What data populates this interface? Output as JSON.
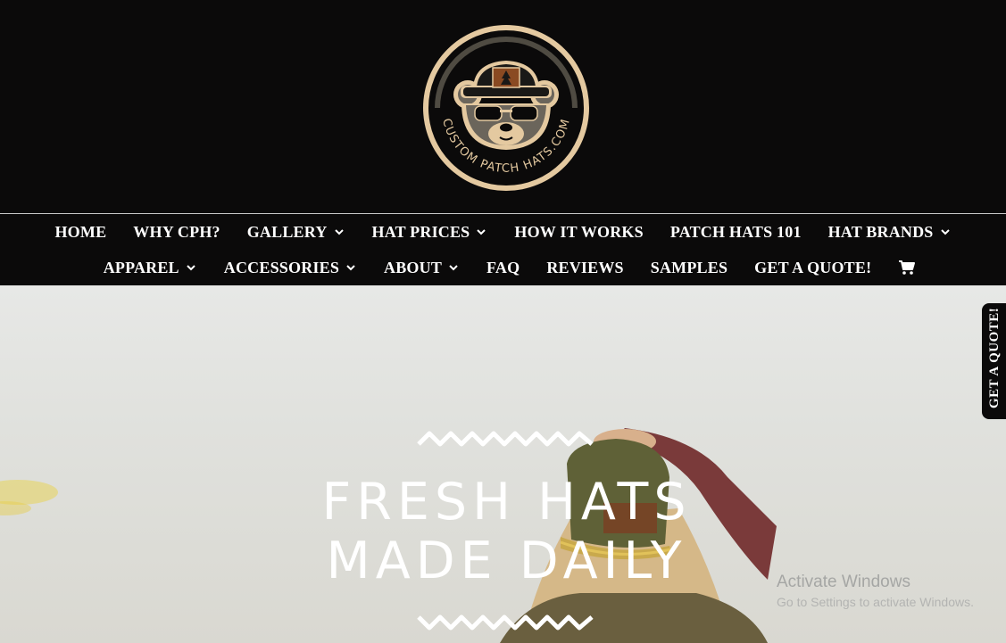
{
  "brand": {
    "logo_text": "CUSTOM PATCH HATS.COM",
    "colors": {
      "bg": "#0b0a0a",
      "ring": "#e4c9a0",
      "accent": "#8a4a22",
      "text": "#ffffff"
    }
  },
  "nav": {
    "row1": [
      {
        "label": "HOME",
        "dropdown": false
      },
      {
        "label": "WHY CPH?",
        "dropdown": false
      },
      {
        "label": "GALLERY",
        "dropdown": true
      },
      {
        "label": "HAT PRICES",
        "dropdown": true
      },
      {
        "label": "HOW IT WORKS",
        "dropdown": false
      },
      {
        "label": "PATCH HATS 101",
        "dropdown": false
      },
      {
        "label": "HAT BRANDS",
        "dropdown": true
      }
    ],
    "row2": [
      {
        "label": "APPAREL",
        "dropdown": true
      },
      {
        "label": "ACCESSORIES",
        "dropdown": true
      },
      {
        "label": "ABOUT",
        "dropdown": true
      },
      {
        "label": "FAQ",
        "dropdown": false
      },
      {
        "label": "REVIEWS",
        "dropdown": false
      },
      {
        "label": "SAMPLES",
        "dropdown": false
      },
      {
        "label": "GET A QUOTE!",
        "dropdown": false
      }
    ],
    "cart_icon": "shopping-cart-icon"
  },
  "hero": {
    "title_line1": "FRESH HATS",
    "title_line2": "MADE DAILY"
  },
  "quote_tab": {
    "label": "GET A QUOTE!"
  },
  "watermark": {
    "line1": "Activate Windows",
    "line2": "Go to Settings to activate Windows."
  }
}
